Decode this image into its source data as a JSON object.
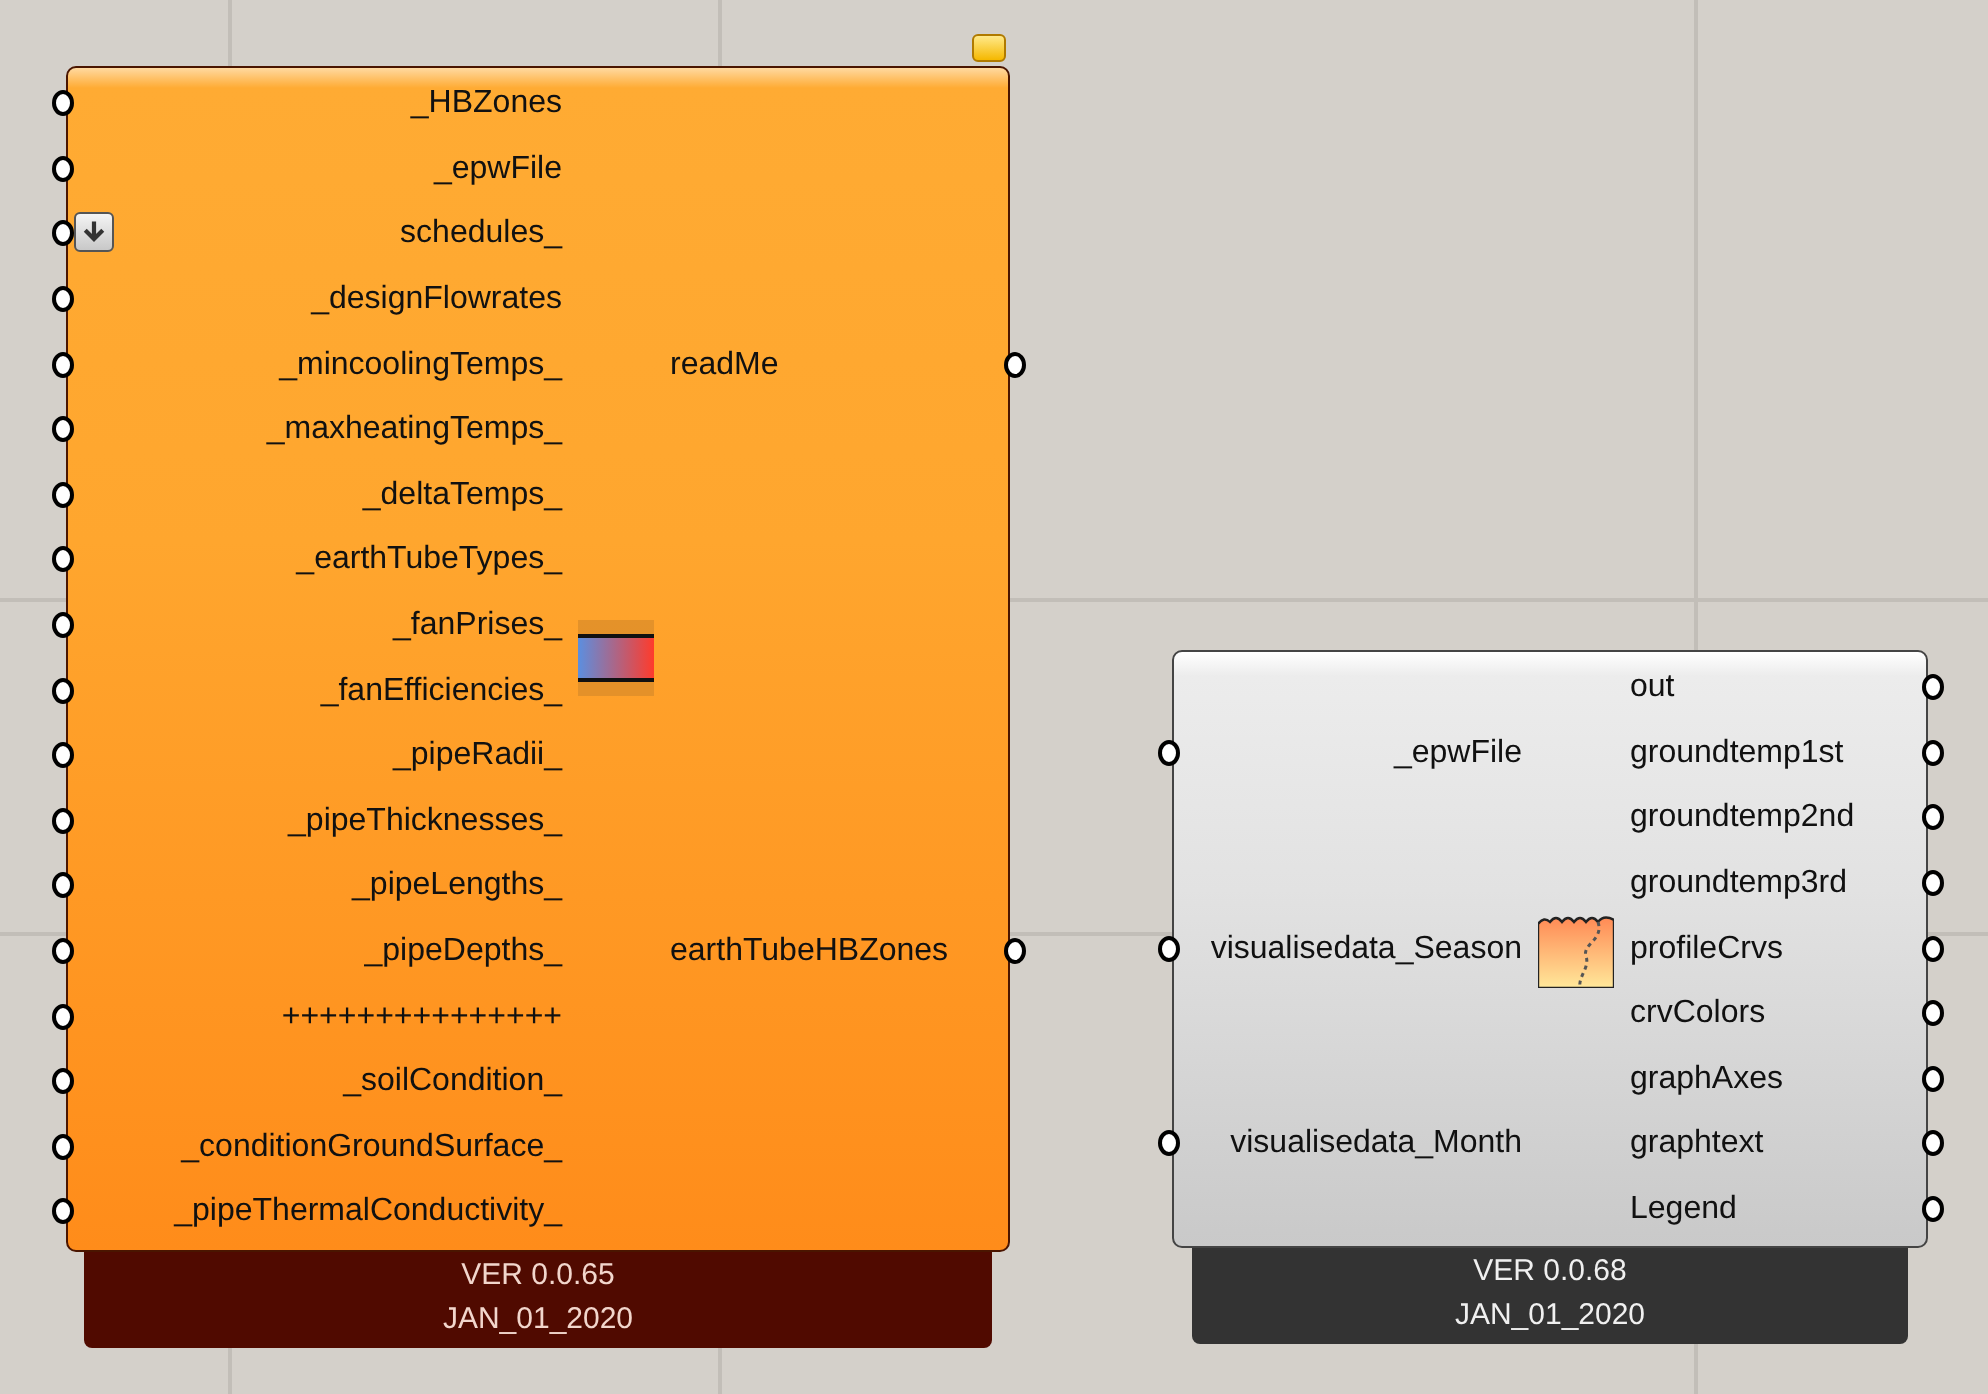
{
  "components": [
    {
      "kind": "warning",
      "message_balloon": true,
      "version": "VER 0.0.65",
      "date": "JAN_01_2020",
      "rows": [
        {
          "input": "_HBZones",
          "input_arrow": false
        },
        {
          "input": "_epwFile",
          "input_arrow": false
        },
        {
          "input": "schedules_",
          "input_arrow": true
        },
        {
          "input": "_designFlowrates",
          "input_arrow": false
        },
        {
          "input": "_mincoolingTemps_",
          "input_arrow": false,
          "output": "readMe"
        },
        {
          "input": "_maxheatingTemps_",
          "input_arrow": false
        },
        {
          "input": "_deltaTemps_",
          "input_arrow": false
        },
        {
          "input": "_earthTubeTypes_",
          "input_arrow": false
        },
        {
          "input": "_fanPrises_",
          "input_arrow": false
        },
        {
          "input": "_fanEfficiencies_",
          "input_arrow": false
        },
        {
          "input": "_pipeRadii_",
          "input_arrow": false
        },
        {
          "input": "_pipeThicknesses_",
          "input_arrow": false
        },
        {
          "input": "_pipeLengths_",
          "input_arrow": false
        },
        {
          "input": "_pipeDepths_",
          "input_arrow": false,
          "output": "earthTubeHBZones"
        },
        {
          "input": "+++++++++++++++",
          "input_arrow": false
        },
        {
          "input": "_soilCondition_",
          "input_arrow": false
        },
        {
          "input": "_conditionGroundSurface_",
          "input_arrow": false
        },
        {
          "input": "_pipeThermalConductivity_",
          "input_arrow": false
        }
      ]
    },
    {
      "kind": "normal",
      "message_balloon": false,
      "version": "VER 0.0.68",
      "date": "JAN_01_2020",
      "rows": [
        {
          "output": "out"
        },
        {
          "input": "_epwFile",
          "input_arrow": false,
          "output": "groundtemp1st"
        },
        {
          "output": "groundtemp2nd"
        },
        {
          "output": "groundtemp3rd"
        },
        {
          "input": "visualisedata_Season",
          "input_arrow": false,
          "output": "profileCrvs"
        },
        {
          "output": "crvColors"
        },
        {
          "output": "graphAxes"
        },
        {
          "input": "visualisedata_Month",
          "input_arrow": false,
          "output": "graphtext"
        },
        {
          "output": "Legend"
        }
      ]
    }
  ]
}
